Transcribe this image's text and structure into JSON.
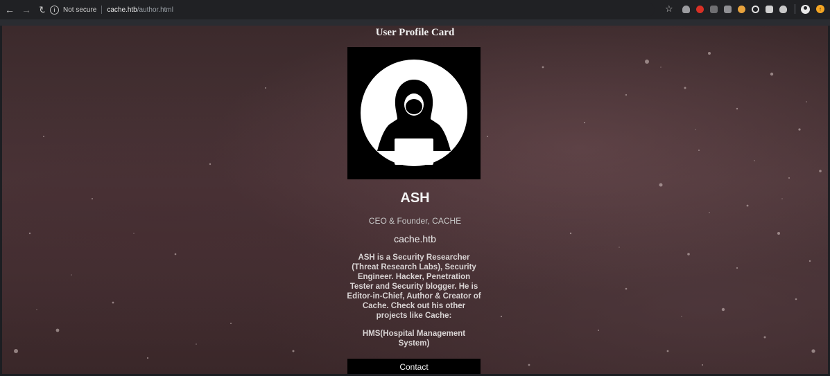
{
  "browser": {
    "security_label": "Not secure",
    "url_host": "cache.htb",
    "url_path": "/author.html",
    "extensions": [
      {
        "icon": "mask-extension-icon",
        "color": "#9c9ca0"
      },
      {
        "icon": "red-dot-extension-icon",
        "color": "#d93025"
      },
      {
        "icon": "wrench-extension-icon",
        "color": "#7d7d80"
      },
      {
        "icon": "table-extension-icon",
        "color": "#8f8f93"
      },
      {
        "icon": "cookie-extension-icon",
        "color": "#e8a33d"
      },
      {
        "icon": "magnifier-extension-icon",
        "color": "#e0e0e0"
      },
      {
        "icon": "puzzle-extension-icon",
        "color": "#d0d0d0"
      },
      {
        "icon": "ninja-extension-icon",
        "color": "#c8c8c8"
      }
    ]
  },
  "card": {
    "title": "User Profile Card",
    "name": "ASH",
    "role": "CEO & Founder, CACHE",
    "site": "cache.htb",
    "bio": "ASH is a Security Researcher (Threat Research Labs), Security Engineer. Hacker, Penetration Tester and Security blogger. He is Editor-in-Chief, Author & Creator of Cache. Check out his other projects like Cache:",
    "project": "HMS(Hospital Management System)",
    "contact_label": "Contact",
    "avatar_icon": "hacker-avatar-icon"
  },
  "colors": {
    "page_background": "#44302f",
    "card_black": "#000000",
    "chrome_background": "#202124"
  }
}
